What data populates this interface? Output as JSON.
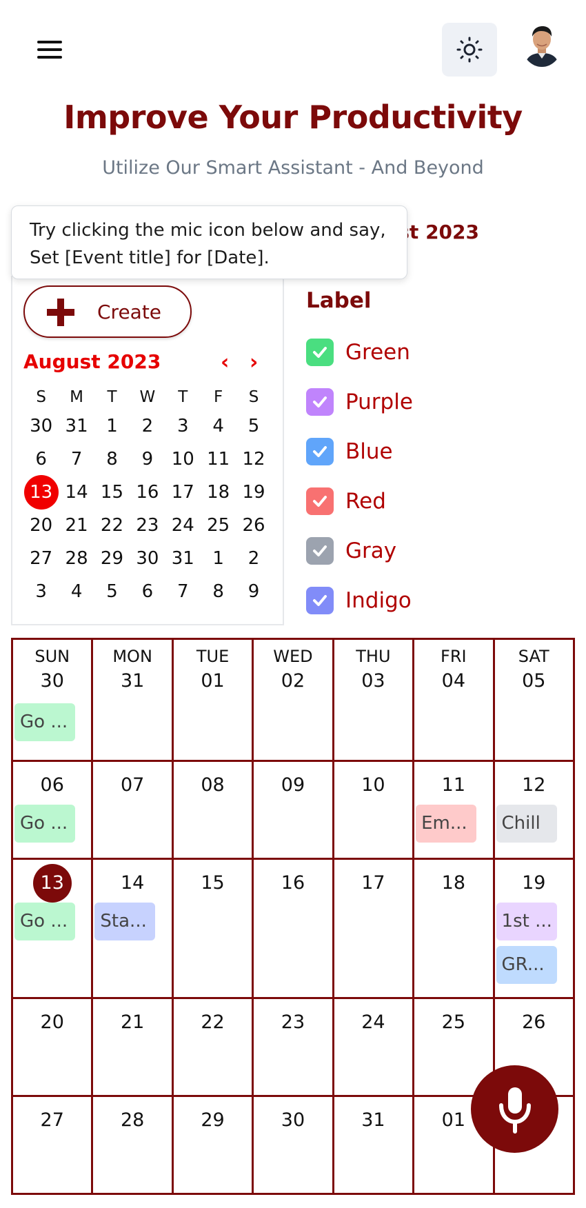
{
  "header": {
    "menu_icon": "hamburger-menu-icon",
    "theme_icon": "sun-icon",
    "avatar": "user-avatar"
  },
  "hero": {
    "title": "Improve Your Productivity",
    "subtitle": "Utilize Our Smart Assistant - And Beyond"
  },
  "month_heading": "August 2023",
  "tooltip": {
    "line1": "Try clicking the mic icon below and say,",
    "line2": "Set [Event title] for [Date]."
  },
  "sidebar": {
    "create_label": "Create",
    "mini_calendar": {
      "month_label": "August 2023",
      "prev": "‹",
      "next": "›",
      "weekdays": [
        "S",
        "M",
        "T",
        "W",
        "T",
        "F",
        "S"
      ],
      "weeks": [
        [
          "30",
          "31",
          "1",
          "2",
          "3",
          "4",
          "5"
        ],
        [
          "6",
          "7",
          "8",
          "9",
          "10",
          "11",
          "12"
        ],
        [
          "13",
          "14",
          "15",
          "16",
          "17",
          "18",
          "19"
        ],
        [
          "20",
          "21",
          "22",
          "23",
          "24",
          "25",
          "26"
        ],
        [
          "27",
          "28",
          "29",
          "30",
          "31",
          "1",
          "2"
        ],
        [
          "3",
          "4",
          "5",
          "6",
          "7",
          "8",
          "9"
        ]
      ],
      "today": "13"
    }
  },
  "labels": {
    "heading": "Label",
    "items": [
      {
        "name": "Green",
        "color": "#4ade80",
        "checked": true
      },
      {
        "name": "Purple",
        "color": "#c084fc",
        "checked": true
      },
      {
        "name": "Blue",
        "color": "#60a5fa",
        "checked": true
      },
      {
        "name": "Red",
        "color": "#f87171",
        "checked": true
      },
      {
        "name": "Gray",
        "color": "#9ca3af",
        "checked": true
      },
      {
        "name": "Indigo",
        "color": "#818cf8",
        "checked": true
      }
    ]
  },
  "calendar": {
    "weekdays": [
      "SUN",
      "MON",
      "TUE",
      "WED",
      "THU",
      "FRI",
      "SAT"
    ],
    "weeks": [
      [
        {
          "day": "30",
          "events": [
            {
              "title": "Go ...",
              "color": "green"
            }
          ]
        },
        {
          "day": "31",
          "events": []
        },
        {
          "day": "01",
          "events": []
        },
        {
          "day": "02",
          "events": []
        },
        {
          "day": "03",
          "events": []
        },
        {
          "day": "04",
          "events": []
        },
        {
          "day": "05",
          "events": []
        }
      ],
      [
        {
          "day": "06",
          "events": [
            {
              "title": "Go ...",
              "color": "green"
            }
          ]
        },
        {
          "day": "07",
          "events": []
        },
        {
          "day": "08",
          "events": []
        },
        {
          "day": "09",
          "events": []
        },
        {
          "day": "10",
          "events": []
        },
        {
          "day": "11",
          "events": [
            {
              "title": "Em...",
              "color": "red"
            }
          ]
        },
        {
          "day": "12",
          "events": [
            {
              "title": "Chill",
              "color": "gray"
            }
          ]
        }
      ],
      [
        {
          "day": "13",
          "today": true,
          "events": [
            {
              "title": "Go ...",
              "color": "green"
            }
          ]
        },
        {
          "day": "14",
          "events": [
            {
              "title": "Sta...",
              "color": "indigo"
            }
          ]
        },
        {
          "day": "15",
          "events": []
        },
        {
          "day": "16",
          "events": []
        },
        {
          "day": "17",
          "events": []
        },
        {
          "day": "18",
          "events": []
        },
        {
          "day": "19",
          "events": [
            {
              "title": "1st ...",
              "color": "purple"
            },
            {
              "title": "GR...",
              "color": "blue"
            }
          ]
        }
      ],
      [
        {
          "day": "20",
          "events": []
        },
        {
          "day": "21",
          "events": []
        },
        {
          "day": "22",
          "events": []
        },
        {
          "day": "23",
          "events": []
        },
        {
          "day": "24",
          "events": []
        },
        {
          "day": "25",
          "events": []
        },
        {
          "day": "26",
          "events": []
        }
      ],
      [
        {
          "day": "27",
          "events": []
        },
        {
          "day": "28",
          "events": []
        },
        {
          "day": "29",
          "events": []
        },
        {
          "day": "30",
          "events": []
        },
        {
          "day": "31",
          "events": []
        },
        {
          "day": "01",
          "events": []
        },
        {
          "day": "",
          "events": []
        }
      ]
    ]
  },
  "mic_button": {
    "icon": "microphone-icon"
  }
}
